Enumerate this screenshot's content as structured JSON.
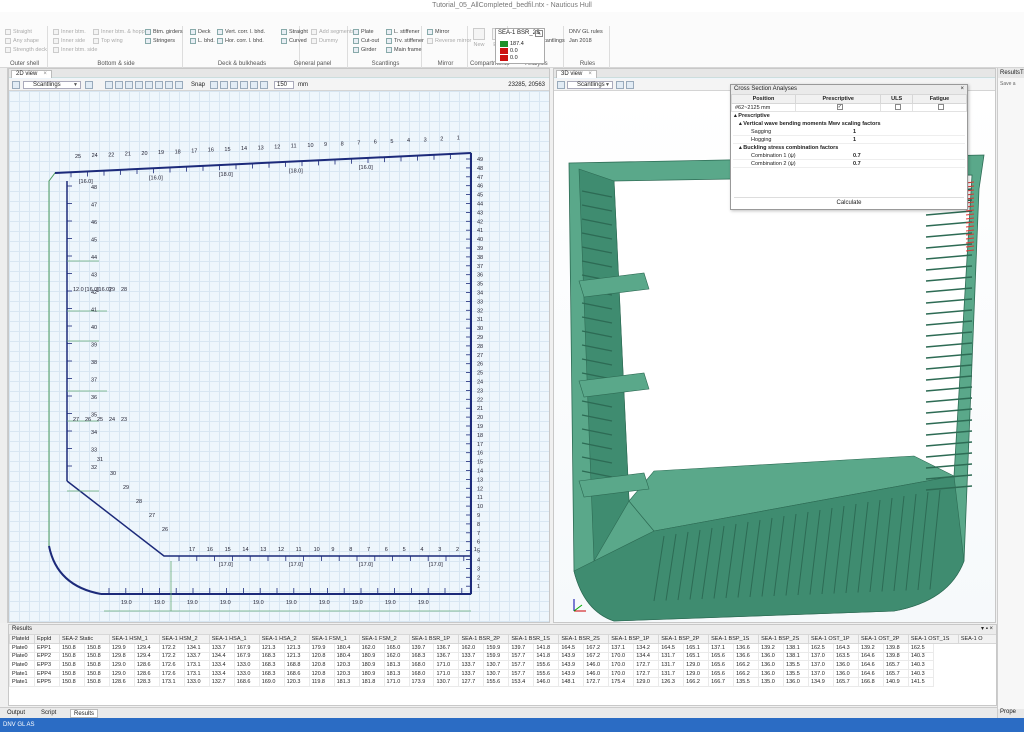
{
  "window": {
    "title": "Tutorial_05_AllCompleted_bedfil.ntx - Nauticus Hull"
  },
  "ribbon": {
    "groups": [
      {
        "caption": "Outer shell",
        "items": [
          "Straight",
          "Any shape",
          "Strength deck"
        ]
      },
      {
        "caption": "Bottom & side",
        "items": [
          "Inner btm.",
          "Inner side",
          "Inner btm. side",
          "Inner btm. & hopper",
          "Top wing",
          "Btm. girders",
          "Stringers"
        ]
      },
      {
        "caption": "Deck & bulkheads",
        "items": [
          "Deck",
          "L. bhd.",
          "Vert. corr. l. bhd.",
          "Hor. corr. l. bhd."
        ]
      },
      {
        "caption": "General panel",
        "items": [
          "Straight",
          "Curved",
          "Add segments",
          "Dummy"
        ]
      },
      {
        "caption": "Scantlings",
        "items": [
          "Plate",
          "Cut-out",
          "Girder",
          "L. stiffener",
          "Trv. stiffener",
          "Main frame"
        ]
      },
      {
        "caption": "Mirror",
        "items": [
          "Mirror",
          "Reverse mirror"
        ]
      },
      {
        "caption": "Compartments",
        "items": [
          "New",
          "Edit"
        ]
      },
      {
        "caption": "Analysis",
        "items": [
          "Run",
          "Update scantlings",
          "Report"
        ]
      },
      {
        "caption": "Rules",
        "items": [
          "DNV GL rules",
          "Jan 2018"
        ]
      }
    ]
  },
  "view2d": {
    "tab": "2D view",
    "mode": "Scantlings",
    "snap_label": "Snap",
    "snap_value": "150",
    "snap_unit": "mm",
    "coords": "23285, 20563",
    "legend": {
      "title": "SEA-1 BSR_2S",
      "entries": [
        "187.4",
        "0.0",
        "0.0"
      ],
      "colors": [
        "#1f8f2a",
        "#cc1111",
        "#cc1111"
      ]
    },
    "labels": {
      "deck_nums": [
        "25",
        "24",
        "22",
        "21",
        "20",
        "19",
        "18",
        "17",
        "16",
        "15",
        "14",
        "13",
        "12",
        "11",
        "10",
        "9",
        "8",
        "7",
        "6",
        "5",
        "4",
        "3",
        "2",
        "1"
      ],
      "deck_tags": [
        "[16.0]",
        "[16.0]",
        "[18.0]",
        "[18.0]",
        "[16.0]"
      ],
      "side_right": [
        "49",
        "48",
        "47",
        "46",
        "45",
        "44",
        "43",
        "42",
        "41",
        "40",
        "39",
        "38",
        "37",
        "36",
        "35",
        "34",
        "33",
        "32",
        "31",
        "30",
        "29",
        "28",
        "27",
        "26",
        "25",
        "24",
        "23",
        "22",
        "21",
        "20",
        "19",
        "18",
        "17",
        "16",
        "15",
        "14",
        "13",
        "12",
        "11",
        "10",
        "9",
        "8",
        "7",
        "6",
        "5",
        "4",
        "3",
        "2",
        "1"
      ],
      "inner_side": [
        "48",
        "47",
        "46",
        "45",
        "44",
        "43",
        "42",
        "41",
        "40",
        "39",
        "38",
        "37",
        "36",
        "35",
        "34",
        "33",
        "32"
      ],
      "hopper": [
        "31",
        "30",
        "29",
        "28",
        "27",
        "26"
      ],
      "inner_btm": [
        "17",
        "16",
        "15",
        "14",
        "13",
        "12",
        "11",
        "10",
        "9",
        "8",
        "7",
        "6",
        "5",
        "4",
        "3",
        "2",
        "1"
      ],
      "inner_btm_tags": [
        "[17.0]",
        "[17.0]",
        "[17.0]",
        "[17.0]"
      ],
      "btm_tags": [
        "19.0",
        "19.0",
        "19.0",
        "19.0",
        "19.0",
        "19.0",
        "19.0",
        "19.0",
        "19.0",
        "19.0"
      ],
      "misc": [
        "12.0",
        "[16.0]",
        "[16.0]",
        "29",
        "28",
        "27",
        "26",
        "25",
        "24",
        "23"
      ]
    }
  },
  "view3d": {
    "tab": "3D view",
    "mode": "Scantlings"
  },
  "cross_section": {
    "title": "Cross Section Analyses",
    "columns": [
      "Position",
      "Prescriptive",
      "ULS",
      "Fatigue"
    ],
    "position_value": "#62~2125 mm",
    "section": "Prescriptive",
    "groups": [
      {
        "title": "Vertical wave bending moments Mwv scaling factors",
        "rows": [
          {
            "label": "Sagging",
            "value": "1"
          },
          {
            "label": "Hogging",
            "value": "1"
          }
        ]
      },
      {
        "title": "Buckling stress combination factors",
        "rows": [
          {
            "label": "Combination 1 (ψ)",
            "value": "0.7"
          },
          {
            "label": "Combination 2 (ψ)",
            "value": "0.7"
          }
        ]
      }
    ],
    "calc_label": "Calculate"
  },
  "results": {
    "title": "Results",
    "columns": [
      "PlateId",
      "EppId",
      "SEA-2 Static",
      "SEA-1 HSM_1",
      "SEA-1 HSM_2",
      "SEA-1 HSA_1",
      "SEA-1 HSA_2",
      "SEA-1 FSM_1",
      "SEA-1 FSM_2",
      "SEA-1 BSR_1P",
      "SEA-1 BSR_2P",
      "SEA-1 BSR_1S",
      "SEA-1 BSR_2S",
      "SEA-1 BSP_1P",
      "SEA-1 BSP_2P",
      "SEA-1 BSP_1S",
      "SEA-1 BSP_2S",
      "SEA-1 OST_1P",
      "SEA-1 OST_2P",
      "SEA-1 OST_1S",
      "SEA-1 O"
    ],
    "rows": [
      [
        "Plate0",
        "EPP1",
        "150.8",
        "150.8",
        "129.9",
        "129.4",
        "172.2",
        "134.1",
        "133.7",
        "167.9",
        "121.3",
        "121.3",
        "179.9",
        "180.4",
        "162.0",
        "165.0",
        "139.7",
        "136.7",
        "162.0",
        "159.9",
        "139.7",
        "141.8",
        "164.5",
        "167.2",
        "137.1",
        "134.2",
        "164.5",
        "165.1",
        "137.1",
        "136.6",
        "139.2",
        "138.1",
        "162.5",
        "164.3",
        "139.2",
        "139.8",
        "162.5"
      ],
      [
        "Plate0",
        "EPP2",
        "150.8",
        "150.8",
        "129.8",
        "129.4",
        "172.2",
        "133.7",
        "134.4",
        "167.9",
        "168.3",
        "121.3",
        "120.8",
        "180.4",
        "180.9",
        "162.0",
        "168.3",
        "136.7",
        "133.7",
        "159.9",
        "157.7",
        "141.8",
        "143.9",
        "167.2",
        "170.0",
        "134.4",
        "131.7",
        "165.1",
        "165.6",
        "136.6",
        "136.0",
        "138.1",
        "137.0",
        "163.5",
        "164.6",
        "139.8",
        "140.3"
      ],
      [
        "Plate0",
        "EPP3",
        "150.8",
        "150.8",
        "129.0",
        "128.6",
        "172.6",
        "173.1",
        "133.4",
        "133.0",
        "168.3",
        "168.8",
        "120.8",
        "120.3",
        "180.9",
        "181.3",
        "168.0",
        "171.0",
        "133.7",
        "130.7",
        "157.7",
        "155.6",
        "143.9",
        "146.0",
        "170.0",
        "172.7",
        "131.7",
        "129.0",
        "165.6",
        "166.2",
        "136.0",
        "135.5",
        "137.0",
        "136.0",
        "164.6",
        "165.7",
        "140.3"
      ],
      [
        "Plate1",
        "EPP4",
        "150.8",
        "150.8",
        "129.0",
        "128.6",
        "172.6",
        "173.1",
        "133.4",
        "133.0",
        "168.3",
        "168.6",
        "120.8",
        "120.3",
        "180.9",
        "181.3",
        "168.0",
        "171.0",
        "133.7",
        "130.7",
        "157.7",
        "155.6",
        "143.9",
        "146.0",
        "170.0",
        "172.7",
        "131.7",
        "129.0",
        "165.6",
        "166.2",
        "136.0",
        "135.5",
        "137.0",
        "136.0",
        "164.6",
        "165.7",
        "140.3"
      ],
      [
        "Plate1",
        "EPP5",
        "150.8",
        "150.8",
        "128.6",
        "128.3",
        "173.1",
        "133.0",
        "132.7",
        "168.6",
        "169.0",
        "120.3",
        "119.8",
        "181.3",
        "181.8",
        "171.0",
        "173.9",
        "130.7",
        "127.7",
        "155.6",
        "153.4",
        "146.0",
        "148.1",
        "172.7",
        "175.4",
        "129.0",
        "126.3",
        "166.2",
        "166.7",
        "135.5",
        "135.0",
        "136.0",
        "134.9",
        "165.7",
        "166.8",
        "140.9",
        "141.5"
      ]
    ]
  },
  "bottom_tabs": [
    "Output",
    "Script",
    "Results"
  ],
  "right_panel": {
    "header": "ResultsTree",
    "item": "Save a",
    "footer": "Prope"
  },
  "status": "DNV GL AS"
}
